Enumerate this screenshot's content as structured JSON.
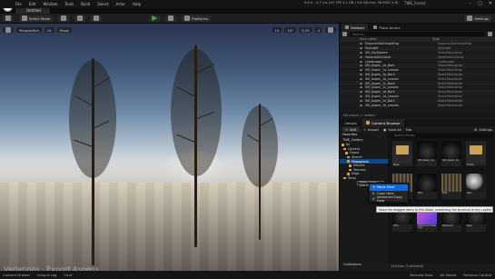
{
  "app": {
    "title": "TWE_Forest",
    "tab": "Untitled",
    "stats": "5.8.0  –  4.7 ms  101 FPS  4.1 GB / 4.6 GB  mm: 58.9GB  (1.6)"
  },
  "menu": [
    "File",
    "Edit",
    "Window",
    "Tools",
    "Build",
    "Select",
    "Actor",
    "Help"
  ],
  "toolbar": {
    "select_mode": "Select Mode",
    "platforms": "Platforms",
    "settings": "Settings"
  },
  "viewport": {
    "perspective": "Perspective",
    "lit": "Lit",
    "show": "Show",
    "grid_value": "10",
    "angle_value": "10°",
    "scale_value": "0.25",
    "camera_speed": "4"
  },
  "outliner": {
    "tab": "Outliner",
    "tab2": "Place Actors",
    "search_placeholder": "Search...",
    "col_item": "Item Label",
    "col_type": "Type",
    "rows": [
      {
        "name": "ExponentialHeightFog",
        "type": "ExponentialHeightFog"
      },
      {
        "name": "SkyLight",
        "type": "SkyLight"
      },
      {
        "name": "SM_SkySphere",
        "type": "StaticMeshActor"
      },
      {
        "name": "VolumetricCloud",
        "type": "VolumetricCloud"
      },
      {
        "name": "Landscape",
        "type": "Landscape"
      },
      {
        "name": "SM_Aspen_1a_Bark",
        "type": "StaticMeshActor"
      },
      {
        "name": "SM_Aspen_1a_Leaves",
        "type": "StaticMeshActor"
      },
      {
        "name": "SM_Aspen_1b_Bark",
        "type": "StaticMeshActor"
      },
      {
        "name": "SM_Aspen_1b_Leaves",
        "type": "StaticMeshActor"
      },
      {
        "name": "SM_Aspen_1c_Back",
        "type": "StaticMeshActor"
      },
      {
        "name": "SM_Aspen_1c_Leaves",
        "type": "StaticMeshActor"
      },
      {
        "name": "SM_Aspen_1d_Bark",
        "type": "StaticMeshActor"
      },
      {
        "name": "SM_Aspen_1d_Leaves",
        "type": "StaticMeshActor"
      },
      {
        "name": "SM_Aspen_1e_Bark",
        "type": "StaticMeshActor"
      },
      {
        "name": "SM_Aspen_1e_Leaves",
        "type": "StaticMeshActor"
      }
    ],
    "count": "136 actors (1 hidden)"
  },
  "content_browser": {
    "tab_details": "Details",
    "tab_cb": "Content Browser",
    "add": "Add",
    "import": "Import",
    "save_all": "Save All",
    "fab": "Fab",
    "settings": "Settings",
    "breadcrumb": [
      "All",
      "Fab",
      "Frame",
      "Megaplants",
      "Folder"
    ],
    "favorites": "Favorites",
    "project": "TWE_Gallery",
    "folders": [
      {
        "name": "All",
        "indent": 2,
        "sel": false
      },
      {
        "name": "Content",
        "indent": 4,
        "sel": false
      },
      {
        "name": "Forest",
        "indent": 6,
        "sel": false
      },
      {
        "name": "Shared",
        "indent": 8,
        "sel": false
      },
      {
        "name": "Megaplants",
        "indent": 8,
        "sel": true
      },
      {
        "name": "Meshes",
        "indent": 10,
        "sel": false
      },
      {
        "name": "Textures",
        "indent": 10,
        "sel": false
      },
      {
        "name": "Maps",
        "indent": 8,
        "sel": false
      },
      {
        "name": "Temp",
        "indent": 4,
        "sel": false
      }
    ],
    "search_placeholder": "Search Folder",
    "tiles": [
      {
        "label": "Meta",
        "kind": "folder"
      },
      {
        "label": "SM_Aspen_1a",
        "kind": "dark"
      },
      {
        "label": "SM_Aspen_1b",
        "kind": "dark"
      },
      {
        "label": "Folder",
        "kind": "folder"
      },
      {
        "label": "M_Bark",
        "kind": "bark"
      },
      {
        "label": "Dfm",
        "kind": "dark"
      },
      {
        "label": "Dfm",
        "kind": "bark"
      },
      {
        "label": "Dfm",
        "kind": "sphere"
      },
      {
        "label": "Dfm",
        "kind": "dark"
      },
      {
        "label": "Unlikened Cells Tga",
        "kind": "pink"
      },
      {
        "label": "Billboard",
        "kind": "dark"
      },
      {
        "label": "Bark",
        "kind": "dark"
      }
    ],
    "collections": "Collections",
    "item_count": "14 items (1 selected)"
  },
  "context_menu": {
    "items": [
      "Move Here",
      "Copy Here",
      "Advanced Copy Here"
    ]
  },
  "drag_chip": "Move / Copy / Link items",
  "tooltip": "Move the dragged items to this folder, preserving the structure of any copied folders",
  "bottom": {
    "drawer": "Content Drawer",
    "output": "Output Log",
    "cmd": "Cmd",
    "derived": "Derived Data",
    "all_saved": "All Saved",
    "source": "Revision Control"
  },
  "watermark": "Variations · Export Aspens",
  "colors": {
    "accent": "#0d6bd8",
    "selected_folder": "#0e4a8a",
    "play": "#3fae3f"
  }
}
